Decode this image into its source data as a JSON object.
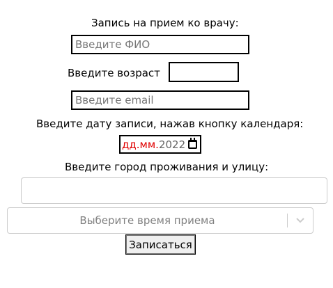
{
  "form": {
    "title": "Запись на прием ко врачу:",
    "name_placeholder": "Введите ФИО",
    "age_label": "Введите возраст",
    "age_value": "",
    "email_placeholder": "Введите email",
    "date_label": "Введите дату записи, нажав кнопку календаря:",
    "date_day": "дд",
    "date_sep": ".",
    "date_month": "мм",
    "date_year": "2022",
    "address_label": "Введите город проживания и улицу:",
    "address_value": "",
    "time_select_placeholder": "Выберите время приема",
    "submit_label": "Записаться"
  },
  "icons": {
    "calendar": "calendar-icon",
    "dropdown": "chevron-down-icon"
  },
  "colors": {
    "date_invalid": "#e00000",
    "border": "#000000",
    "select_border": "#cccccc"
  }
}
